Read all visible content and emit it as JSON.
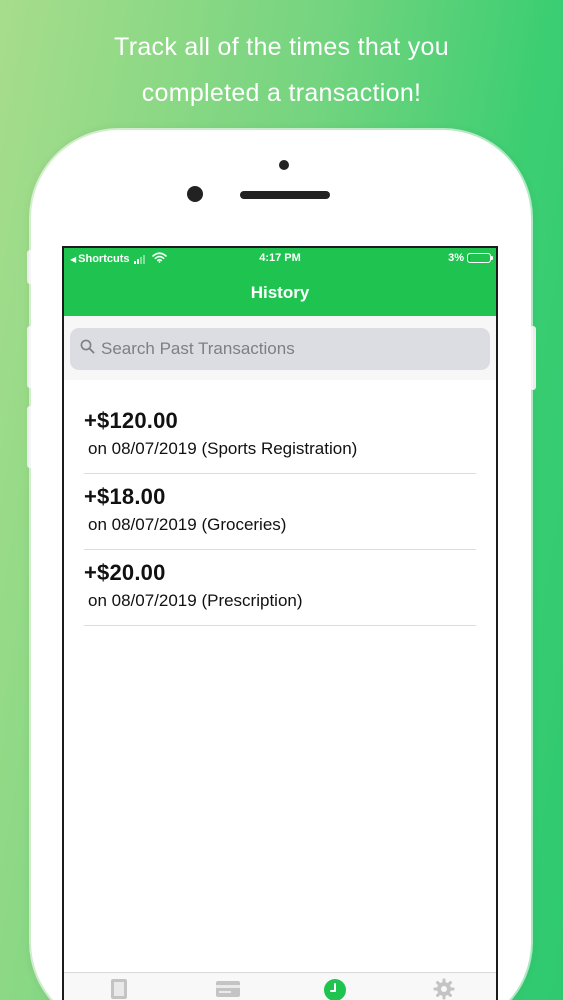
{
  "headline": {
    "line1": "Track all of the times that you",
    "line2": "completed a transaction!"
  },
  "status_bar": {
    "back_app": "Shortcuts",
    "time": "4:17 PM",
    "battery": "3%",
    "battery_level": 0.03
  },
  "nav": {
    "title": "History"
  },
  "search": {
    "placeholder": "Search Past Transactions",
    "value": ""
  },
  "transactions": [
    {
      "amount": "+$120.00",
      "detail": "on 08/07/2019 (Sports Registration)"
    },
    {
      "amount": "+$18.00",
      "detail": "on 08/07/2019 (Groceries)"
    },
    {
      "amount": "+$20.00",
      "detail": "on 08/07/2019 (Prescription)"
    }
  ],
  "tab_bar": {
    "tabs": [
      {
        "icon": "calculator-icon",
        "selected": false
      },
      {
        "icon": "credit-card-icon",
        "selected": false
      },
      {
        "icon": "clock-icon",
        "selected": true
      },
      {
        "icon": "gear-icon",
        "selected": false
      }
    ]
  },
  "colors": {
    "accent": "#1fc450",
    "battery_low": "#ff3b30",
    "background_left": "#a7dd8c",
    "background_right": "#2fc970"
  }
}
